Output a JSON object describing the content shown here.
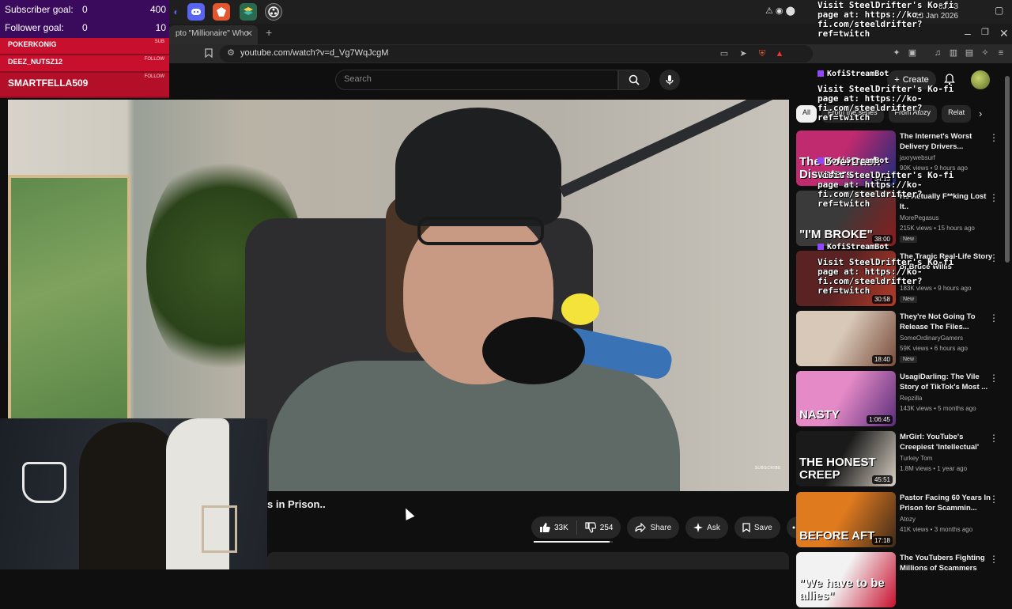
{
  "stream_overlay": {
    "goals": [
      {
        "label": "Subscriber goal:",
        "current": "0",
        "target": "400"
      },
      {
        "label": "Follower goal:",
        "current": "0",
        "target": "10"
      }
    ],
    "alerts": [
      {
        "name": "POKERKONIG",
        "type": "SUB"
      },
      {
        "name": "DEEZ_NUTSZ12",
        "type": "FOLLOW"
      },
      {
        "name": "SMARTFELLA509",
        "type": "FOLLOW"
      }
    ],
    "bot_messages": [
      {
        "name": "",
        "text": "Visit SteelDrifter's Ko-fi\npage at: https://ko-\nfi.com/steeldrifter?\nref=twitch"
      },
      {
        "name": "KofiStreamBot",
        "text": "Visit SteelDrifter's Ko-fi\npage at: https://ko-\nfi.com/steeldrifter?\nref=twitch"
      },
      {
        "name": "KofiStreamBot",
        "text": "Visit SteelDrifter's Ko-fi\npage at: https://ko-\nfi.com/steeldrifter?\nref=twitch"
      },
      {
        "name": "KofiStreamBot",
        "text": "Visit SteelDrifter's Ko-fi\npage at: https://ko-\nfi.com/steeldrifter?\nref=twitch"
      }
    ]
  },
  "system": {
    "time": "02:43",
    "date": "13 Jan 2026"
  },
  "browser": {
    "tab_title": "pto \"Millionaire\" Who",
    "url": "youtube.com/watch?v=d_Vg7WqJcgM"
  },
  "youtube": {
    "search_placeholder": "Search",
    "create_label": "Create",
    "video_title_visible": "s in Prison..",
    "player_watermark": "SUBSCRIBE",
    "likes": "33K",
    "dislikes": "254",
    "like_ratio": 0.96,
    "share_label": "Share",
    "ask_label": "Ask",
    "save_label": "Save",
    "chips": [
      {
        "label": "All",
        "active": true
      },
      {
        "label": "From the series",
        "active": false
      },
      {
        "label": "From Atozy",
        "active": false
      },
      {
        "label": "Relat",
        "active": false
      }
    ],
    "recommendations": [
      {
        "title": "The Internet's Worst Delivery Drivers...",
        "channel": "jaxrywebsurf",
        "views": "90K views • 9 hours ago",
        "duration": "34:13",
        "badge": "",
        "thumb_text": "The DoorDash Disasters",
        "colors": [
          "#c02a6e",
          "#1b2b7a"
        ]
      },
      {
        "title": "He Actually F**king Lost It..",
        "channel": "MorePegasus",
        "views": "215K views • 15 hours ago",
        "duration": "38:00",
        "badge": "New",
        "thumb_text": "\"I'M BROKE\"",
        "colors": [
          "#3a3a3a",
          "#8a1c1c"
        ]
      },
      {
        "title": "The Tragic Real-Life Story of Bruce Willis",
        "channel": "",
        "views": "183K views • 9 hours ago",
        "duration": "30:58",
        "badge": "New",
        "thumb_text": "",
        "colors": [
          "#5a2222",
          "#b33b2a"
        ]
      },
      {
        "title": "They're Not Going To Release The Files...",
        "channel": "SomeOrdinaryGamers",
        "views": "59K views • 6 hours ago",
        "duration": "18:40",
        "badge": "New",
        "thumb_text": "",
        "colors": [
          "#d8c8b8",
          "#7a4c3a"
        ]
      },
      {
        "title": "UsagiDarling: The Vile Story of TikTok's Most ...",
        "channel": "Repzilla",
        "views": "143K views • 5 months ago",
        "duration": "1:06:45",
        "badge": "",
        "thumb_text": "NASTY",
        "colors": [
          "#e58ac7",
          "#5a2d7a"
        ]
      },
      {
        "title": "MrGirl: YouTube's Creepiest 'Intellectual'",
        "channel": "Turkey Tom",
        "views": "1.8M views • 1 year ago",
        "duration": "45:51",
        "badge": "",
        "thumb_text": "THE HONEST CREEP",
        "colors": [
          "#1a1a1a",
          "#d9d1c4"
        ]
      },
      {
        "title": "Pastor Facing 60 Years In Prison for Scammin...",
        "channel": "Atozy",
        "views": "41K views • 3 months ago",
        "duration": "17:18",
        "badge": "",
        "thumb_text": "BEFORE  AFT",
        "colors": [
          "#e07a1f",
          "#3d2a1a"
        ]
      },
      {
        "title": "The YouTubers Fighting Millions of Scammers",
        "channel": "",
        "views": "",
        "duration": "",
        "badge": "",
        "thumb_text": "\"We have to be allies\"",
        "colors": [
          "#f2f2f2",
          "#c8102e"
        ]
      }
    ]
  }
}
